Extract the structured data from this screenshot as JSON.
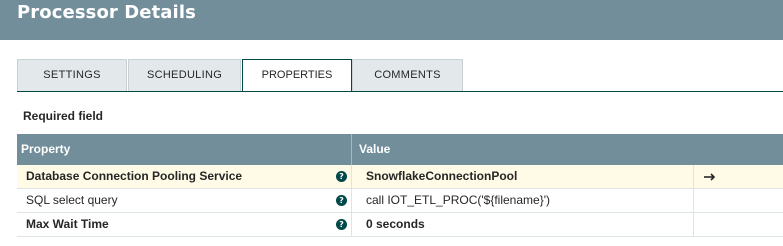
{
  "header": {
    "title": "Processor Details"
  },
  "tabs": [
    {
      "label": "SETTINGS",
      "active": false
    },
    {
      "label": "SCHEDULING",
      "active": false
    },
    {
      "label": "PROPERTIES",
      "active": true
    },
    {
      "label": "COMMENTS",
      "active": false
    }
  ],
  "required_label": "Required field",
  "grid": {
    "columns": {
      "property": "Property",
      "value": "Value"
    },
    "rows": [
      {
        "property": "Database Connection Pooling Service",
        "value": "SnowflakeConnectionPool",
        "required": true,
        "has_goto": true,
        "help_icon": "question-circle-icon",
        "goto_icon": "arrow-right-icon"
      },
      {
        "property": "SQL select query",
        "value": "call IOT_ETL_PROC('${filename}')",
        "required": false,
        "has_goto": false,
        "help_icon": "question-circle-icon"
      },
      {
        "property": "Max Wait Time",
        "value": "0 seconds",
        "required": true,
        "has_goto": false,
        "help_icon": "question-circle-icon"
      }
    ]
  },
  "colors": {
    "header_bg": "#728e9b",
    "accent": "#004849",
    "selected_row": "#fffbe6",
    "tab_bg": "#e3e8eb"
  }
}
